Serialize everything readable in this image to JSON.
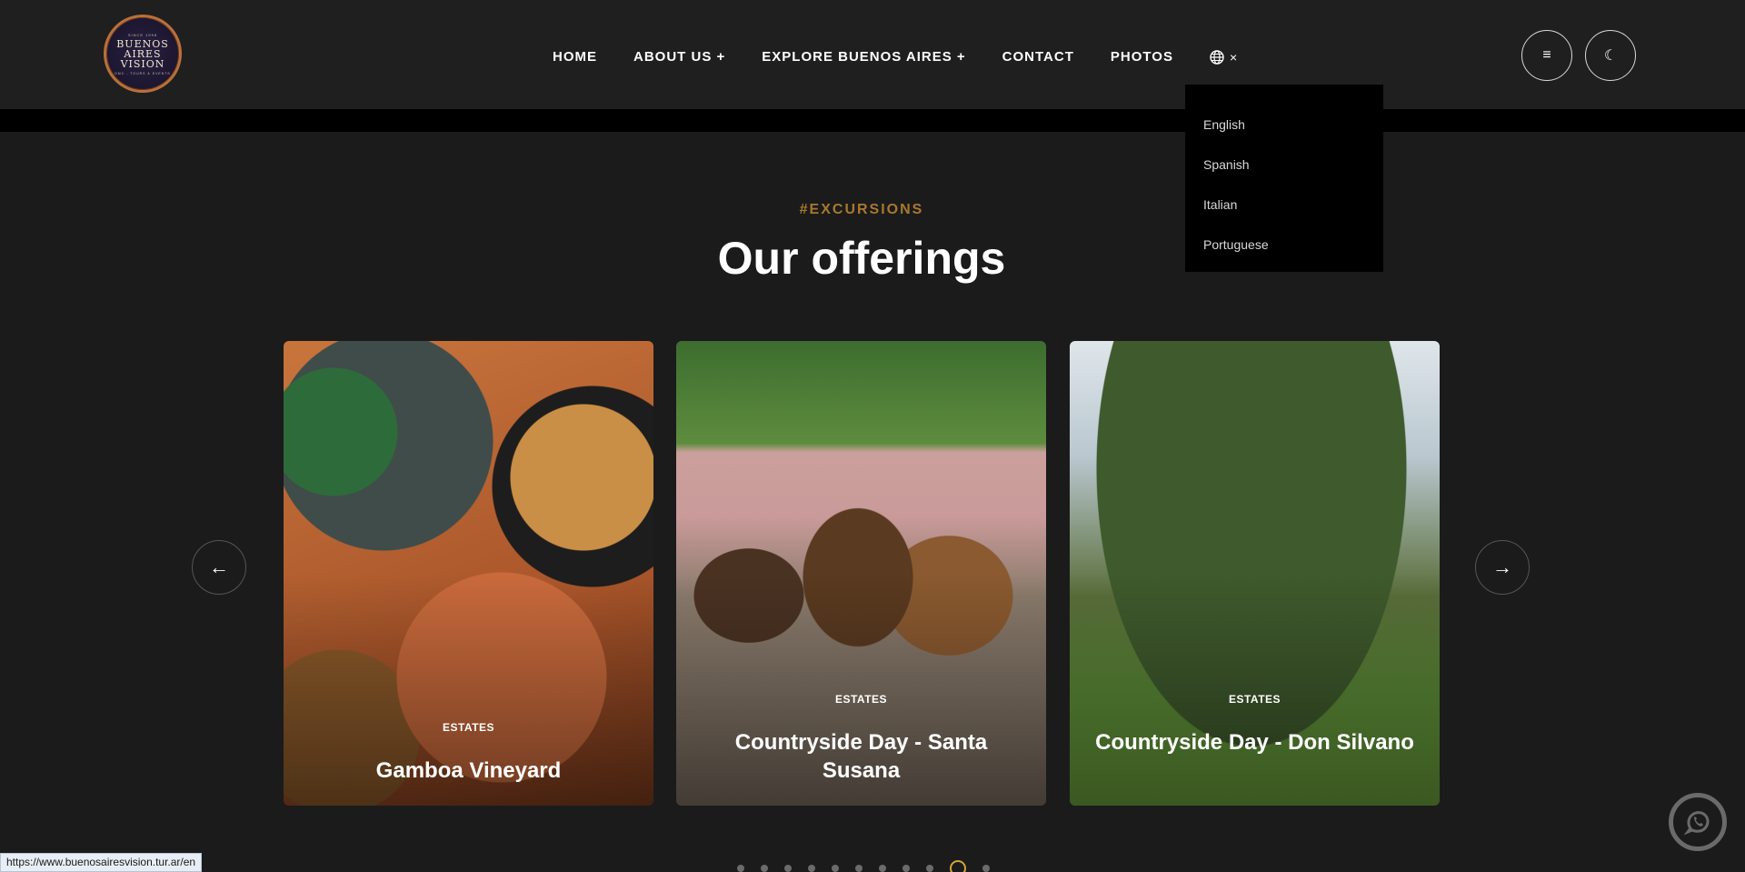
{
  "logo": {
    "top_text": "SINCE 1998",
    "lines": [
      "BUENOS",
      "AIRES",
      "VISION"
    ],
    "sub_text": "DMC - TOURS & EVENTS"
  },
  "nav": {
    "items": [
      "HOME",
      "ABOUT US +",
      "EXPLORE BUENOS AIRES +",
      "CONTACT",
      "PHOTOS"
    ],
    "lang_close": "×",
    "menu_icon": "≡",
    "theme_icon": "☾"
  },
  "language_menu": {
    "options": [
      "English",
      "Spanish",
      "Italian",
      "Portuguese"
    ]
  },
  "section": {
    "eyebrow": "#EXCURSIONS",
    "title": "Our offerings"
  },
  "carousel": {
    "cards": [
      {
        "tag": "ESTATES",
        "title": "Gamboa Vineyard"
      },
      {
        "tag": "ESTATES",
        "title": "Countryside Day - Santa Susana"
      },
      {
        "tag": "ESTATES",
        "title": "Countryside Day - Don Silvano"
      }
    ],
    "prev_icon": "←",
    "next_icon": "→",
    "dot_count": 11,
    "active_dot_index": 9
  },
  "status_bar": {
    "url": "https://www.buenosairesvision.tur.ar/en"
  },
  "colors": {
    "accent": "#a8782f",
    "background": "#1b1b1b",
    "header": "#1f1f1f"
  }
}
